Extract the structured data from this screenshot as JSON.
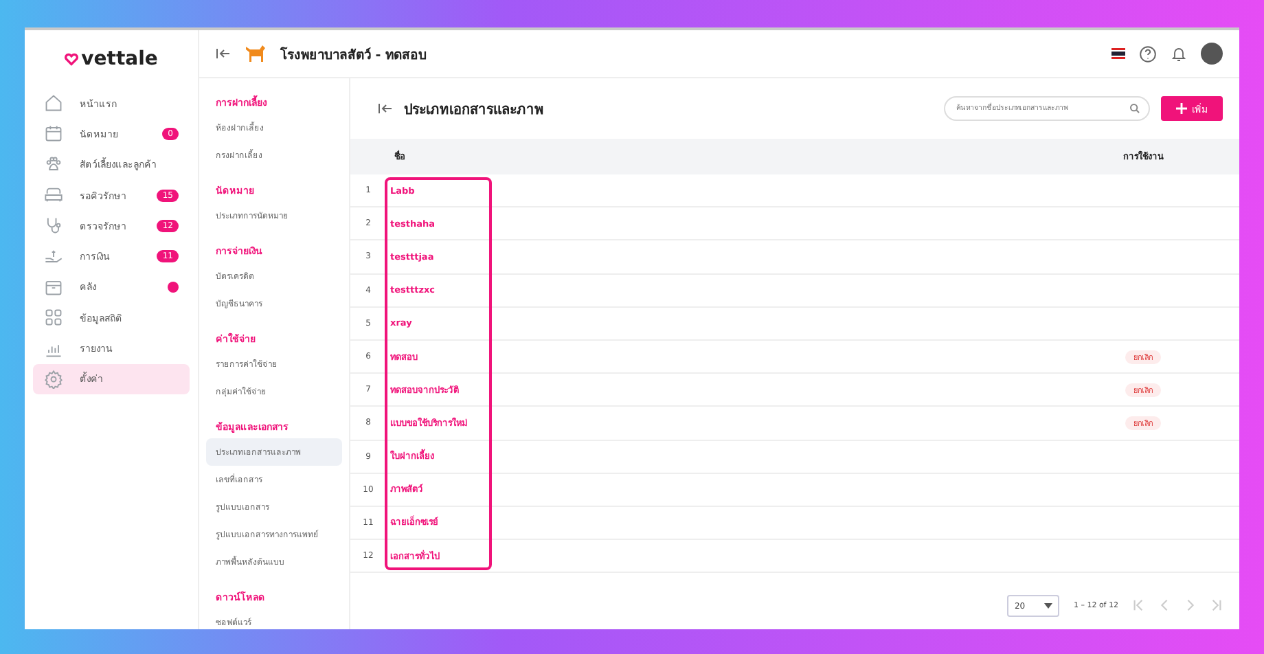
{
  "brand": {
    "name": "vettale"
  },
  "nav": [
    {
      "label": "หน้าแรก",
      "selected": false
    },
    {
      "label": "นัดหมาย",
      "badge": "0",
      "selected": false
    },
    {
      "label": "สัตว์เลี้ยงและลูกค้า",
      "selected": false
    },
    {
      "label": "รอคิวรักษา",
      "badge": "15",
      "selected": false
    },
    {
      "label": "ตรวจรักษา",
      "badge": "12",
      "selected": false
    },
    {
      "label": "การเงิน",
      "badge": "11",
      "selected": false
    },
    {
      "label": "คลัง",
      "dot": true,
      "selected": false
    },
    {
      "label": "ข้อมูลสถิติ",
      "selected": false
    },
    {
      "label": "รายงาน",
      "selected": false
    },
    {
      "label": "ตั้งค่า",
      "selected": true
    }
  ],
  "header": {
    "title": "โรงพยาบาลสัตว์ - ทดสอบ"
  },
  "settings_menu": [
    {
      "heading": "การฝากเลี้ยง",
      "items": [
        {
          "label": "ห้องฝากเลี้ยง",
          "selected": false
        },
        {
          "label": "กรงฝากเลี้ยง",
          "selected": false
        }
      ]
    },
    {
      "heading": "นัดหมาย",
      "items": [
        {
          "label": "ประเภทการนัดหมาย",
          "selected": false
        }
      ]
    },
    {
      "heading": "การจ่ายเงิน",
      "items": [
        {
          "label": "บัตรเครดิต",
          "selected": false
        },
        {
          "label": "บัญชีธนาคาร",
          "selected": false
        }
      ]
    },
    {
      "heading": "ค่าใช้จ่าย",
      "items": [
        {
          "label": "รายการค่าใช้จ่าย",
          "selected": false
        },
        {
          "label": "กลุ่มค่าใช้จ่าย",
          "selected": false
        }
      ]
    },
    {
      "heading": "ข้อมูลและเอกสาร",
      "items": [
        {
          "label": "ประเภทเอกสารและภาพ",
          "selected": true
        },
        {
          "label": "เลขที่เอกสาร",
          "selected": false
        },
        {
          "label": "รูปแบบเอกสาร",
          "selected": false
        },
        {
          "label": "รูปแบบเอกสารทางการแพทย์",
          "selected": false
        },
        {
          "label": "ภาพพื้นหลังต้นแบบ",
          "selected": false
        }
      ]
    },
    {
      "heading": "ดาวน์โหลด",
      "items": [
        {
          "label": "ซอฟต์แวร์",
          "selected": false
        }
      ]
    }
  ],
  "page": {
    "title": "ประเภทเอกสารและภาพ",
    "search": {
      "placeholder": "ค้นหาจากชื่อประเภทเอกสารและภาพ"
    },
    "add_button": "เพิ่ม"
  },
  "table": {
    "columns": [
      "ชื่อ",
      "การใช้งาน"
    ],
    "rows": [
      {
        "no": "1",
        "name": "Labb"
      },
      {
        "no": "2",
        "name": "testhaha"
      },
      {
        "no": "3",
        "name": "testttjaa"
      },
      {
        "no": "4",
        "name": "testttzxc"
      },
      {
        "no": "5",
        "name": "xray"
      },
      {
        "no": "6",
        "name": "ทดสอบ",
        "status": "ยกเลิก"
      },
      {
        "no": "7",
        "name": "ทดสอบจากประวัติ",
        "status": "ยกเลิก"
      },
      {
        "no": "8",
        "name": "แบบขอใช้บริการใหม่",
        "status": "ยกเลิก"
      },
      {
        "no": "9",
        "name": "ใบฝากเลี้ยง"
      },
      {
        "no": "10",
        "name": "ภาพสัตว์"
      },
      {
        "no": "11",
        "name": "ฉายเอ็กซเรย์"
      },
      {
        "no": "12",
        "name": "เอกสารทั่วไป"
      }
    ]
  },
  "pagination": {
    "page_size": "20",
    "range": "1 – 12 of 12",
    "first_disabled": true,
    "prev_disabled": true,
    "next_disabled": true,
    "last_disabled": true
  }
}
